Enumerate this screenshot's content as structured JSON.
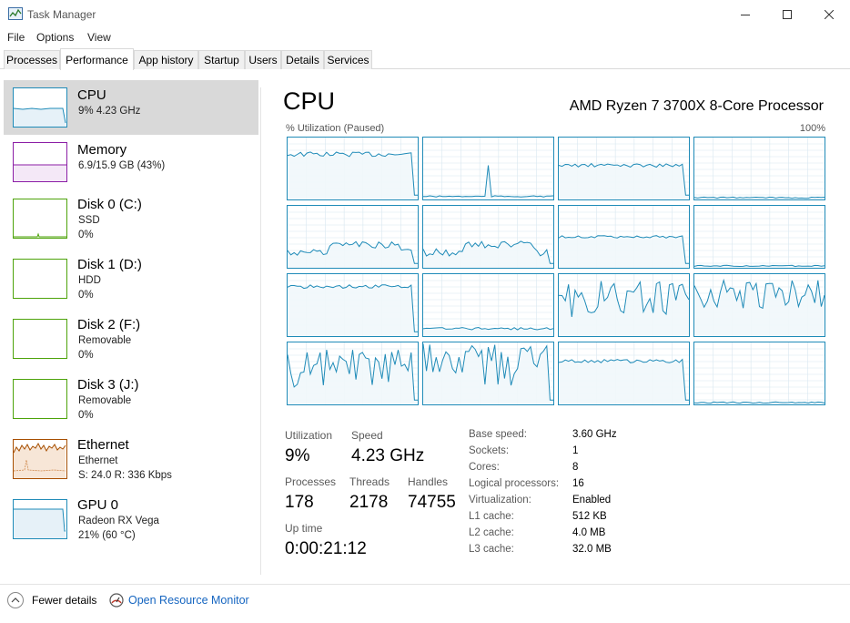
{
  "window": {
    "title": "Task Manager"
  },
  "menu": [
    "File",
    "Options",
    "View"
  ],
  "tabs": [
    "Processes",
    "Performance",
    "App history",
    "Startup",
    "Users",
    "Details",
    "Services"
  ],
  "sidebar": [
    {
      "name": "CPU",
      "line1": "9%  4.23 GHz",
      "line2": "",
      "line3": "",
      "color": "#1f8bb8"
    },
    {
      "name": "Memory",
      "line1": "6.9/15.9 GB (43%)",
      "line2": "",
      "line3": "",
      "color": "#8b1ea6"
    },
    {
      "name": "Disk 0 (C:)",
      "line1": "SSD",
      "line2": "0%",
      "line3": "",
      "color": "#4da30a"
    },
    {
      "name": "Disk 1 (D:)",
      "line1": "HDD",
      "line2": "0%",
      "line3": "",
      "color": "#4da30a"
    },
    {
      "name": "Disk 2 (F:)",
      "line1": "Removable",
      "line2": "0%",
      "line3": "",
      "color": "#4da30a"
    },
    {
      "name": "Disk 3 (J:)",
      "line1": "Removable",
      "line2": "0%",
      "line3": "",
      "color": "#4da30a"
    },
    {
      "name": "Ethernet",
      "line1": "Ethernet",
      "line2": "S: 24.0  R: 336 Kbps",
      "line3": "",
      "color": "#a74f01"
    },
    {
      "name": "GPU 0",
      "line1": "Radeon RX Vega",
      "line2": "21% (60 °C)",
      "line3": "",
      "color": "#1f8bb8"
    }
  ],
  "main": {
    "title": "CPU",
    "model": "AMD Ryzen 7 3700X 8-Core Processor",
    "util_label": "% Utilization (Paused)",
    "util_max": "100%",
    "graph_color": "#1f8bb8",
    "graph_fill": "#f1f7fb",
    "grid_color": "#d8e7f0"
  },
  "stats": {
    "utilization_label": "Utilization",
    "utilization": "9%",
    "speed_label": "Speed",
    "speed": "4.23 GHz",
    "processes_label": "Processes",
    "processes": "178",
    "threads_label": "Threads",
    "threads": "2178",
    "handles_label": "Handles",
    "handles": "74755",
    "uptime_label": "Up time",
    "uptime": "0:00:21:12"
  },
  "specs": [
    {
      "label": "Base speed:",
      "value": "3.60 GHz"
    },
    {
      "label": "Sockets:",
      "value": "1"
    },
    {
      "label": "Cores:",
      "value": "8"
    },
    {
      "label": "Logical processors:",
      "value": "16"
    },
    {
      "label": "Virtualization:",
      "value": "Enabled"
    },
    {
      "label": "L1 cache:",
      "value": "512 KB"
    },
    {
      "label": "L2 cache:",
      "value": "4.0 MB"
    },
    {
      "label": "L3 cache:",
      "value": "32.0 MB"
    }
  ],
  "footer": {
    "fewer": "Fewer details",
    "resource_monitor": "Open Resource Monitor"
  }
}
